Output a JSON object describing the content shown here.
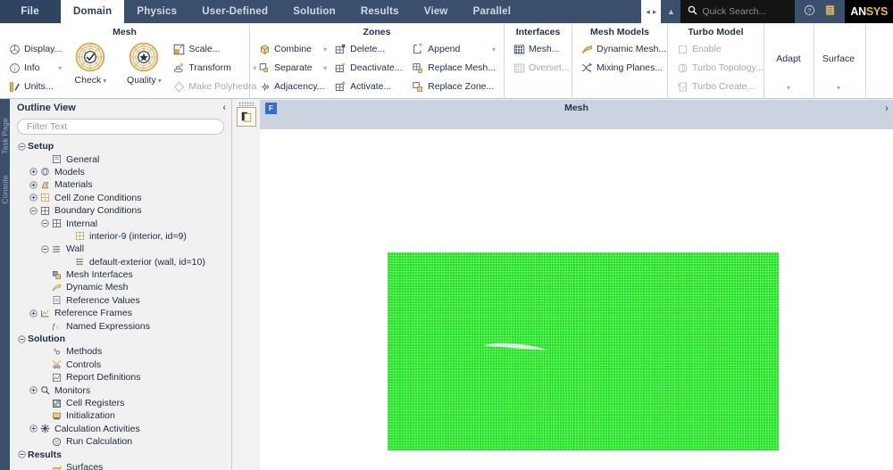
{
  "app": {
    "brand_an": "AN",
    "brand_sys": "SYS",
    "file_tab": "File"
  },
  "tabbar": {
    "tabs": [
      {
        "label": "File",
        "active": false,
        "is_file": true
      },
      {
        "label": "Domain",
        "active": true,
        "is_file": false
      },
      {
        "label": "Physics",
        "active": false,
        "is_file": false
      },
      {
        "label": "User-Defined",
        "active": false,
        "is_file": false
      },
      {
        "label": "Solution",
        "active": false,
        "is_file": false
      },
      {
        "label": "Results",
        "active": false,
        "is_file": false
      },
      {
        "label": "View",
        "active": false,
        "is_file": false
      },
      {
        "label": "Parallel",
        "active": false,
        "is_file": false
      }
    ],
    "nav_prev": "◂",
    "nav_next": "▸",
    "collapse_ribbon": "▲",
    "search_icon": "search-icon",
    "search_placeholder": "Quick Search...",
    "help_icon": "help-icon",
    "panel_icon": "panel-list-icon"
  },
  "ribbon": {
    "groups": [
      {
        "title": "Mesh",
        "columns": [
          {
            "type": "small",
            "items": [
              {
                "label": "Display...",
                "icon": "display-icon",
                "disabled": false,
                "caret": false
              },
              {
                "label": "Info",
                "icon": "info-icon",
                "disabled": false,
                "caret": true
              },
              {
                "label": "Units...",
                "icon": "units-icon",
                "disabled": false,
                "caret": false
              }
            ]
          },
          {
            "type": "big",
            "items": [
              {
                "label": "Check",
                "icon": "check-wheel-icon",
                "caret": true
              },
              {
                "label": "Quality",
                "icon": "quality-wheel-icon",
                "caret": true
              }
            ]
          },
          {
            "type": "small",
            "items": [
              {
                "label": "Scale...",
                "icon": "scale-icon",
                "disabled": false,
                "caret": false
              },
              {
                "label": "Transform",
                "icon": "transform-icon",
                "disabled": false,
                "caret": true
              },
              {
                "label": "Make Polyhedra",
                "icon": "polyhedra-icon",
                "disabled": true,
                "caret": false
              }
            ]
          }
        ]
      },
      {
        "title": "Zones",
        "columns": [
          {
            "type": "small",
            "items": [
              {
                "label": "Combine",
                "icon": "combine-icon",
                "disabled": false,
                "caret": true
              },
              {
                "label": "Separate",
                "icon": "separate-icon",
                "disabled": false,
                "caret": true
              },
              {
                "label": "Adjacency...",
                "icon": "adjacency-icon",
                "disabled": false,
                "caret": false
              }
            ]
          },
          {
            "type": "small",
            "items": [
              {
                "label": "Delete...",
                "icon": "delete-zone-icon",
                "disabled": false,
                "caret": false
              },
              {
                "label": "Deactivate...",
                "icon": "deactivate-zone-icon",
                "disabled": false,
                "caret": false
              },
              {
                "label": "Activate...",
                "icon": "activate-zone-icon",
                "disabled": false,
                "caret": false
              }
            ]
          },
          {
            "type": "small",
            "items": [
              {
                "label": "Append",
                "icon": "append-icon",
                "disabled": false,
                "caret": true
              },
              {
                "label": "Replace Mesh...",
                "icon": "replace-mesh-icon",
                "disabled": false,
                "caret": false
              },
              {
                "label": "Replace Zone...",
                "icon": "replace-zone-icon",
                "disabled": false,
                "caret": false
              }
            ]
          }
        ]
      },
      {
        "title": "Interfaces",
        "columns": [
          {
            "type": "small",
            "items": [
              {
                "label": "Mesh...",
                "icon": "mesh-interface-icon",
                "disabled": false,
                "caret": false
              },
              {
                "label": "Overset...",
                "icon": "overset-interface-icon",
                "disabled": true,
                "caret": false
              }
            ]
          }
        ]
      },
      {
        "title": "Mesh Models",
        "columns": [
          {
            "type": "small",
            "items": [
              {
                "label": "Dynamic Mesh...",
                "icon": "dynamic-mesh-icon",
                "disabled": false,
                "caret": false
              },
              {
                "label": "Mixing Planes...",
                "icon": "mixing-planes-icon",
                "disabled": false,
                "caret": false
              }
            ]
          }
        ]
      },
      {
        "title": "Turbo Model",
        "columns": [
          {
            "type": "small",
            "items": [
              {
                "label": "Enable",
                "icon": "checkbox-icon",
                "disabled": true,
                "caret": false
              },
              {
                "label": "Turbo Topology...",
                "icon": "turbo-topology-icon",
                "disabled": true,
                "caret": false
              },
              {
                "label": "Turbo Create...",
                "icon": "turbo-create-icon",
                "disabled": true,
                "caret": false
              }
            ]
          }
        ]
      }
    ],
    "vertical_buttons": [
      {
        "label": "Adapt",
        "caret": "▾"
      },
      {
        "label": "Surface",
        "caret": "▾"
      }
    ]
  },
  "left_strip": {
    "tabs": [
      {
        "label": "Task Page"
      },
      {
        "label": "Console"
      }
    ]
  },
  "outline": {
    "title": "Outline View",
    "collapse_icon": "chevron-left-icon",
    "filter_placeholder": "Filter Text",
    "tree": [
      {
        "label": "Setup",
        "depth": 0,
        "bold": true,
        "expander": "minus",
        "icon": ""
      },
      {
        "label": "General",
        "depth": 2,
        "bold": false,
        "expander": "none",
        "icon": "general-icon"
      },
      {
        "label": "Models",
        "depth": 1,
        "bold": false,
        "expander": "plus",
        "icon": "models-icon"
      },
      {
        "label": "Materials",
        "depth": 1,
        "bold": false,
        "expander": "plus",
        "icon": "materials-icon"
      },
      {
        "label": "Cell Zone Conditions",
        "depth": 1,
        "bold": false,
        "expander": "plus",
        "icon": "cellzone-icon"
      },
      {
        "label": "Boundary Conditions",
        "depth": 1,
        "bold": false,
        "expander": "minus",
        "icon": "boundary-icon"
      },
      {
        "label": "Internal",
        "depth": 2,
        "bold": false,
        "expander": "minus",
        "icon": "internal-icon"
      },
      {
        "label": "interior-9 (interior, id=9)",
        "depth": 4,
        "bold": false,
        "expander": "none",
        "icon": "interior-icon"
      },
      {
        "label": "Wall",
        "depth": 2,
        "bold": false,
        "expander": "minus",
        "icon": "wall-icon"
      },
      {
        "label": "default-exterior (wall, id=10)",
        "depth": 4,
        "bold": false,
        "expander": "none",
        "icon": "wall-icon"
      },
      {
        "label": "Mesh Interfaces",
        "depth": 2,
        "bold": false,
        "expander": "none",
        "icon": "mesh-interfaces-icon"
      },
      {
        "label": "Dynamic Mesh",
        "depth": 2,
        "bold": false,
        "expander": "none",
        "icon": "dynamic-mesh-icon"
      },
      {
        "label": "Reference Values",
        "depth": 2,
        "bold": false,
        "expander": "none",
        "icon": "reference-values-icon"
      },
      {
        "label": "Reference Frames",
        "depth": 1,
        "bold": false,
        "expander": "plus",
        "icon": "reference-frames-icon"
      },
      {
        "label": "Named Expressions",
        "depth": 2,
        "bold": false,
        "expander": "none",
        "icon": "named-expressions-icon"
      },
      {
        "label": "Solution",
        "depth": 0,
        "bold": true,
        "expander": "minus",
        "icon": ""
      },
      {
        "label": "Methods",
        "depth": 2,
        "bold": false,
        "expander": "none",
        "icon": "methods-icon"
      },
      {
        "label": "Controls",
        "depth": 2,
        "bold": false,
        "expander": "none",
        "icon": "controls-icon"
      },
      {
        "label": "Report Definitions",
        "depth": 2,
        "bold": false,
        "expander": "none",
        "icon": "report-definitions-icon"
      },
      {
        "label": "Monitors",
        "depth": 1,
        "bold": false,
        "expander": "plus",
        "icon": "monitors-icon"
      },
      {
        "label": "Cell Registers",
        "depth": 2,
        "bold": false,
        "expander": "none",
        "icon": "cell-registers-icon"
      },
      {
        "label": "Initialization",
        "depth": 2,
        "bold": false,
        "expander": "none",
        "icon": "initialization-icon"
      },
      {
        "label": "Calculation Activities",
        "depth": 1,
        "bold": false,
        "expander": "plus",
        "icon": "calculation-activities-icon"
      },
      {
        "label": "Run Calculation",
        "depth": 2,
        "bold": false,
        "expander": "none",
        "icon": "run-calculation-icon"
      },
      {
        "label": "Results",
        "depth": 0,
        "bold": true,
        "expander": "minus",
        "icon": ""
      },
      {
        "label": "Surfaces",
        "depth": 2,
        "bold": false,
        "expander": "none",
        "icon": "surfaces-icon"
      }
    ]
  },
  "graphics": {
    "panel_tool_icon": "copy-window-icon",
    "fluent_tab_label": "F",
    "title": "Mesh",
    "next_icon": "chevron-right-icon",
    "mesh_color": "#18e818",
    "airfoil_color": "#e8e8ea",
    "background_color": "#ffffff"
  }
}
